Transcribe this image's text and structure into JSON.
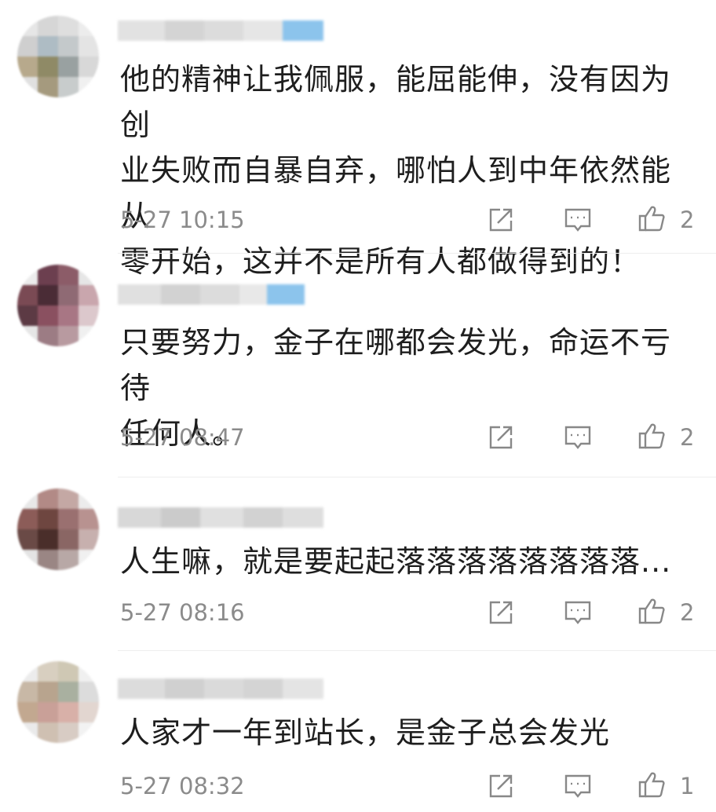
{
  "comments": [
    {
      "text": "他的精神让我佩服，能屈能伸，没有因为创\n业失败而自暴自弃，哪怕人到中年依然能从\n零开始，这并不是所有人都做得到的！",
      "time": "5-27 10:15",
      "likes": "2"
    },
    {
      "text": "只要努力，金子在哪都会发光，命运不亏待\n任何人。",
      "time": "5-27 08:47",
      "likes": "2"
    },
    {
      "text": "人生嘛，就是要起起落落落落落落落落...",
      "time": "5-27 08:16",
      "likes": "2"
    },
    {
      "text": "人家才一年到站长，是金子总会发光",
      "time": "5-27 08:32",
      "likes": "1"
    }
  ],
  "icons": {
    "share": "share-icon",
    "reply": "comment-icon",
    "like": "thumbs-up-icon"
  },
  "colors": {
    "text": "#1e1e1e",
    "meta": "#8b8b8b",
    "blurred_name_accent": "#8cc4ec"
  }
}
